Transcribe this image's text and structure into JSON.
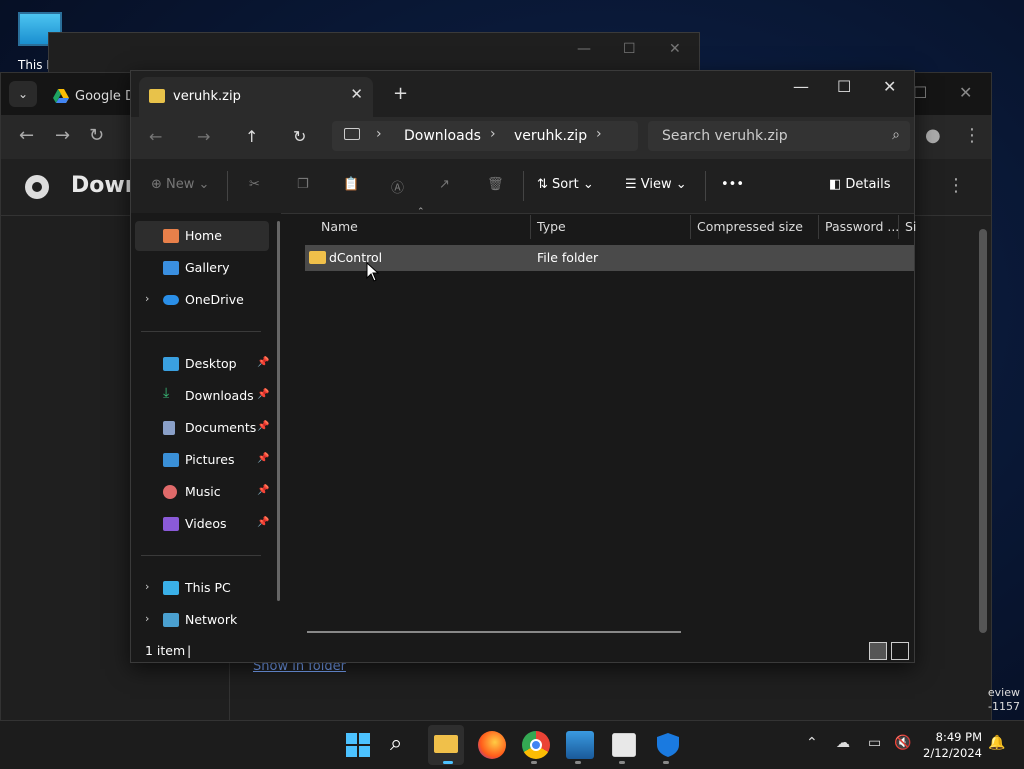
{
  "desktop": {
    "icon_label": "This P"
  },
  "chrome": {
    "tab_title": "Google Dr",
    "page_title": "Down",
    "show_folder": "Show in folder"
  },
  "watermark": {
    "line1": "eview",
    "line2": "-1157"
  },
  "explorer": {
    "tab_title": "veruhk.zip",
    "breadcrumb": [
      "Downloads",
      "veruhk.zip"
    ],
    "search_placeholder": "Search veruhk.zip",
    "commands": {
      "new": "New",
      "sort": "Sort",
      "view": "View",
      "more": "•••",
      "details": "Details"
    },
    "nav": {
      "home": "Home",
      "gallery": "Gallery",
      "onedrive": "OneDrive",
      "desktop": "Desktop",
      "downloads": "Downloads",
      "documents": "Documents",
      "pictures": "Pictures",
      "music": "Music",
      "videos": "Videos",
      "thispc": "This PC",
      "network": "Network"
    },
    "columns": [
      "Name",
      "Type",
      "Compressed size",
      "Password ...",
      "Si"
    ],
    "rows": [
      {
        "name": "dControl",
        "type": "File folder"
      }
    ],
    "status": "1 item"
  },
  "taskbar": {
    "time": "8:49 PM",
    "date": "2/12/2024"
  },
  "colors": {
    "accent": "#4cc2ff",
    "folder": "#f0c04a",
    "selection": "#4a4a4a"
  }
}
